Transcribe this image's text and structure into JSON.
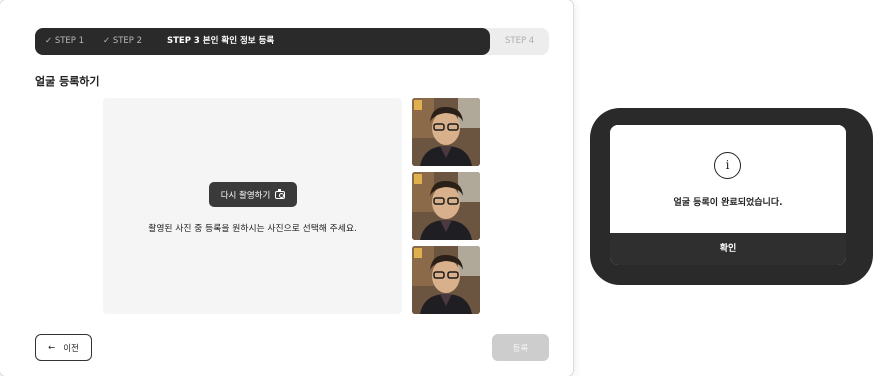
{
  "stepper": {
    "step1": "✓ STEP 1",
    "step2": "✓ STEP 2",
    "step3": "STEP 3  본인 확인 정보 등록",
    "step4": "STEP 4"
  },
  "section_title": "얼굴 등록하기",
  "capture": {
    "retake_label": "다시 촬영하기",
    "instruction": "촬영된 사진 중 등록을 원하시는 사진으로 선택해 주세요."
  },
  "thumbnails": [
    "face-photo-1",
    "face-photo-2",
    "face-photo-3"
  ],
  "footer": {
    "prev_arrow": "←",
    "prev_label": "이전",
    "register_label": "등록"
  },
  "modal": {
    "icon": "info-icon",
    "icon_glyph": "i",
    "message": "얼굴 등록이 완료되었습니다.",
    "confirm_label": "확인"
  },
  "colors": {
    "accent_dark": "#2a2a2b",
    "disabled_button": "#cdcdcd",
    "capture_bg": "#f5f5f5"
  }
}
